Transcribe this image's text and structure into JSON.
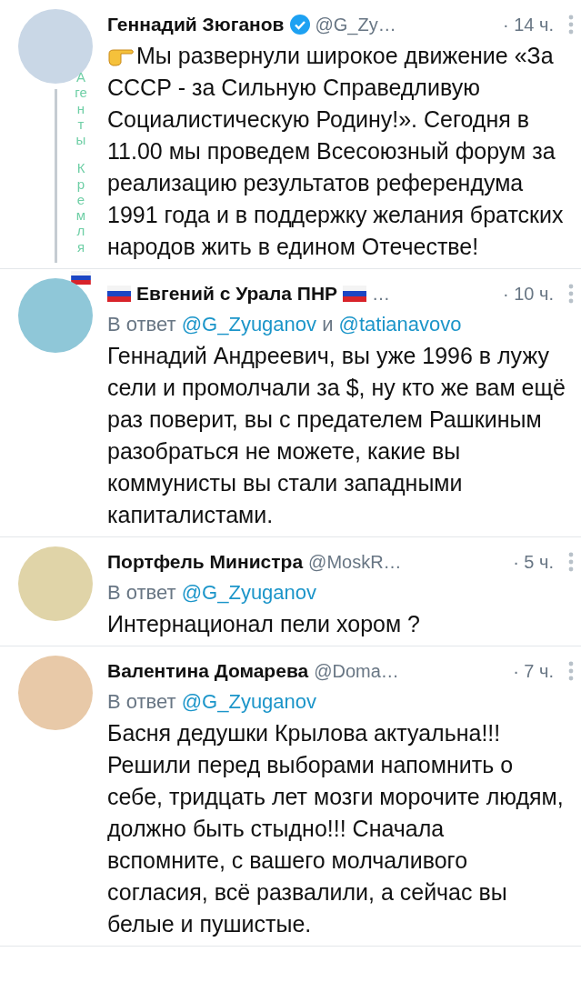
{
  "tweets": [
    {
      "name": "Геннадий Зюганов",
      "verified": true,
      "handle": "@G_Zy…",
      "time": "· 14 ч.",
      "pointing_hand": true,
      "text": "Мы развернули широкое движение «За СССР - за Сильную Справедливую Социалистическую Родину!». Сегодня в 11.00 мы проведем Всесоюзный форум за реализацию результатов референдума 1991 года и в поддержку желания братских народов жить в едином Отечестве!",
      "thread": true,
      "side_caption": "Агенты Кремля",
      "caption_flag": true
    },
    {
      "name": "Евгений с Урала ПНР",
      "flag_before": true,
      "flag_after": true,
      "handle": "…",
      "time": "· 10 ч.",
      "reply_to": {
        "prefix": "В ответ",
        "mentions": [
          "@G_Zyuganov",
          "@tatianavovo"
        ],
        "joiner": "и"
      },
      "text": "Геннадий Андреевич, вы уже 1996 в лужу сели и промолчали за $, ну кто же вам ещё раз поверит, вы с предателем Рашкиным разобраться не можете, какие вы коммунисты вы стали западными капиталистами."
    },
    {
      "name": "Портфель Министра",
      "handle": "@MoskR…",
      "time": "· 5 ч.",
      "reply_to": {
        "prefix": "В ответ",
        "mentions": [
          "@G_Zyuganov"
        ]
      },
      "text": "Интернационал пели хором ?"
    },
    {
      "name": "Валентина Домарева",
      "handle": "@Doma…",
      "time": "· 7 ч.",
      "reply_to": {
        "prefix": "В ответ",
        "mentions": [
          "@G_Zyuganov"
        ]
      },
      "text": "Басня дедушки Крылова актуальна!!! Решили перед выборами напомнить о себе, тридцать лет мозги морочите людям, должно быть стыдно!!! Сначала вспомните, с вашего молчаливого согласия, всё развалили, а сейчас вы белые и пушистые."
    }
  ]
}
